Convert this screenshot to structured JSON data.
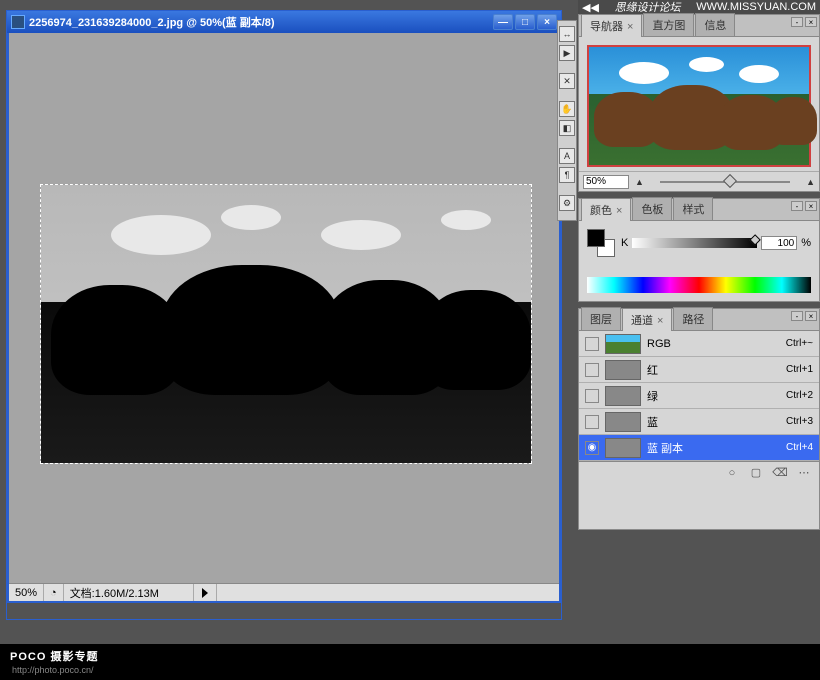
{
  "topbar": {
    "brand": "思缘设计论坛",
    "url": "WWW.MISSYUAN.COM"
  },
  "doc": {
    "title": "2256974_231639284000_2.jpg @ 50%(蓝 副本/8)",
    "winbtns": {
      "min": "—",
      "max": "□",
      "close": "×"
    },
    "status": {
      "zoom": "50%",
      "info": "文档:1.60M/2.13M"
    }
  },
  "tools": [
    "↔",
    "▶",
    "✕",
    "✋",
    "◧",
    "A",
    "¶",
    "⚙"
  ],
  "panels": {
    "nav": {
      "tabs": [
        "导航器",
        "直方图",
        "信息"
      ],
      "zoom": "50%"
    },
    "color": {
      "tabs": [
        "颜色",
        "色板",
        "样式"
      ],
      "klabel": "K",
      "kval": "100",
      "kunit": "%"
    },
    "channels": {
      "tabs": [
        "图层",
        "通道",
        "路径"
      ],
      "rows": [
        {
          "name": "RGB",
          "sc": "Ctrl+~",
          "thumb": "rgb"
        },
        {
          "name": "红",
          "sc": "Ctrl+1"
        },
        {
          "name": "绿",
          "sc": "Ctrl+2"
        },
        {
          "name": "蓝",
          "sc": "Ctrl+3"
        },
        {
          "name": "蓝 副本",
          "sc": "Ctrl+4",
          "sel": true,
          "eye": true
        }
      ],
      "boticons": [
        "○",
        "▢",
        "⌫",
        "⋯"
      ]
    }
  },
  "footer": {
    "brand": "POCO 摄影专题",
    "sub": "http://photo.poco.cn/"
  }
}
